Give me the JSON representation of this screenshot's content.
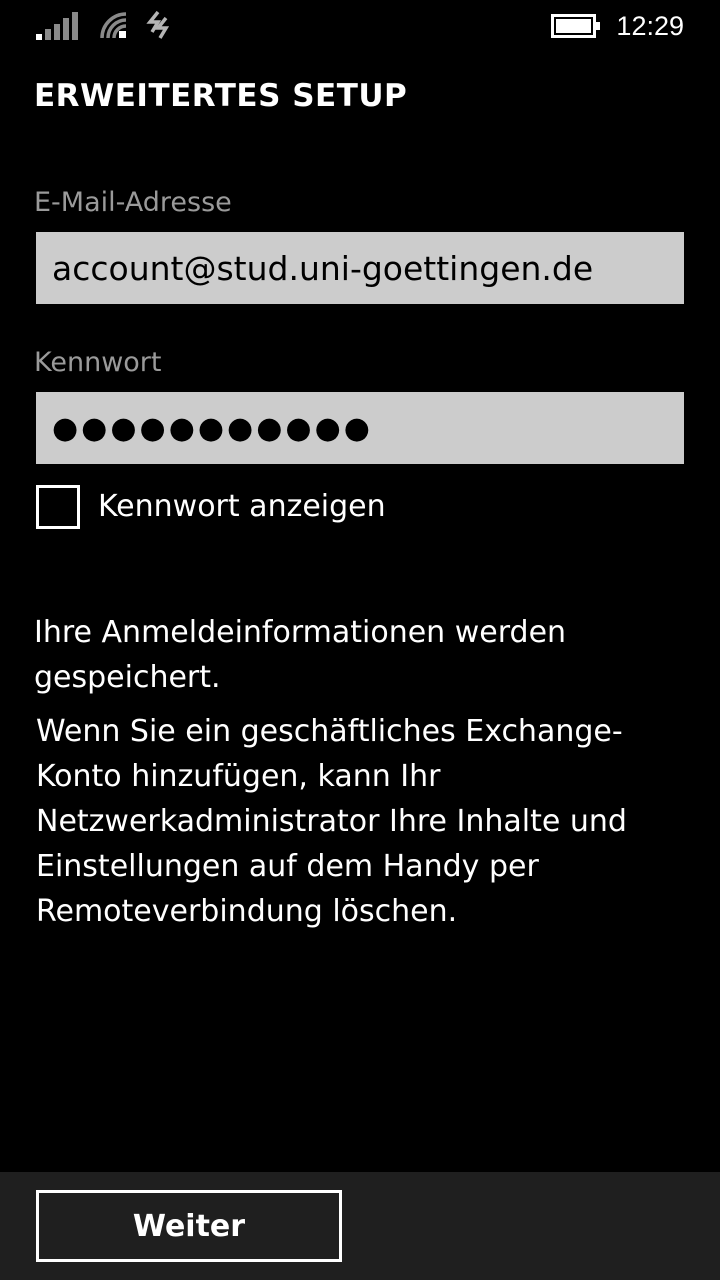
{
  "status_bar": {
    "time": "12:29",
    "icons": [
      "signal-strength-icon",
      "wifi-icon",
      "data-sense-icon",
      "battery-icon"
    ]
  },
  "page": {
    "title": "ERWEITERTES SETUP"
  },
  "form": {
    "email": {
      "label": "E-Mail-Adresse",
      "value": "account@stud.uni-goettingen.de"
    },
    "password": {
      "label": "Kennwort",
      "value": "●●●●●●●●●●●"
    },
    "show_password": {
      "label": "Kennwort anzeigen",
      "checked": false
    }
  },
  "info": {
    "line1": "Ihre Anmeldeinformationen werden gespeichert.",
    "line2": "Wenn Sie ein geschäftliches Exchange-Konto hinzufügen, kann Ihr Netzwerkadministrator Ihre Inhalte und Einstellungen auf dem Handy per Remoteverbindung löschen."
  },
  "app_bar": {
    "next_label": "Weiter"
  },
  "colors": {
    "background": "#000000",
    "field_background": "#cccccc",
    "label_gray": "#9a9a9a",
    "app_bar": "#1f1f1f"
  }
}
